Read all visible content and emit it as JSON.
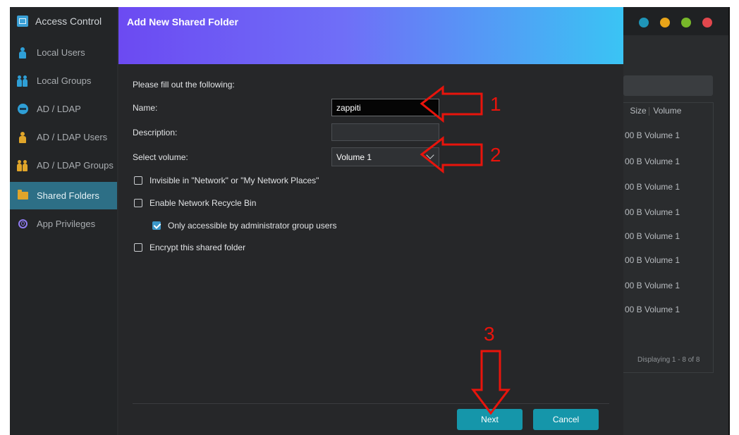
{
  "app": {
    "title": "Access Control"
  },
  "sidebar": {
    "items": [
      {
        "label": "Local Users",
        "icon": "user-icon"
      },
      {
        "label": "Local Groups",
        "icon": "group-icon"
      },
      {
        "label": "AD / LDAP",
        "icon": "ad-ldap-icon"
      },
      {
        "label": "AD / LDAP Users",
        "icon": "user-icon"
      },
      {
        "label": "AD / LDAP Groups",
        "icon": "group-icon"
      },
      {
        "label": "Shared Folders",
        "icon": "folder-icon",
        "active": true
      },
      {
        "label": "App Privileges",
        "icon": "app-privileges-icon"
      }
    ]
  },
  "background_table": {
    "columns": [
      "Size",
      "Volume"
    ],
    "rows": [
      {
        "size": "00 B",
        "volume": "Volume 1"
      },
      {
        "size": "00 B",
        "volume": "Volume 1"
      },
      {
        "size": "00 B",
        "volume": "Volume 1"
      },
      {
        "size": "00 B",
        "volume": "Volume 1"
      },
      {
        "size": "00 B",
        "volume": "Volume 1"
      },
      {
        "size": "00 B",
        "volume": "Volume 1"
      },
      {
        "size": "00 B",
        "volume": "Volume 1"
      },
      {
        "size": "00 B",
        "volume": "Volume 1"
      }
    ],
    "footer": "Displaying 1 - 8 of 8"
  },
  "dialog": {
    "title": "Add New Shared Folder",
    "intro": "Please fill out the following:",
    "name_label": "Name:",
    "name_value": "zappiti",
    "description_label": "Description:",
    "description_value": "",
    "volume_label": "Select volume:",
    "volume_value": "Volume 1",
    "options": [
      {
        "label": "Invisible in \"Network\" or \"My Network Places\"",
        "checked": false
      },
      {
        "label": "Enable Network Recycle Bin",
        "checked": false
      },
      {
        "label": "Only accessible by administrator group users",
        "checked": true
      },
      {
        "label": "Encrypt this shared folder",
        "checked": false
      }
    ],
    "next_label": "Next",
    "cancel_label": "Cancel"
  },
  "annotations": {
    "step1": "1",
    "step2": "2",
    "step3": "3"
  },
  "colors": {
    "accent": "#1596aa",
    "header_gradient_start": "#6c4af2",
    "header_gradient_end": "#3ac4f4",
    "annotation_red": "#e8140c",
    "window_dots": [
      "#1f95b8",
      "#e8a419",
      "#78b82a",
      "#e2474d"
    ]
  }
}
